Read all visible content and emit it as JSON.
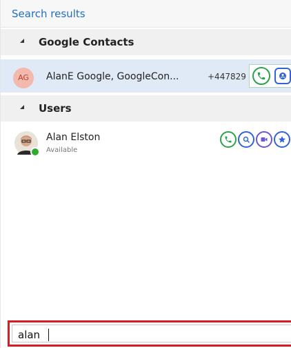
{
  "header": {
    "title": "Search results"
  },
  "groups": [
    {
      "label": "Google Contacts"
    },
    {
      "label": "Users"
    }
  ],
  "google_contact": {
    "initials": "AG",
    "name": "AlanE Google, GoogleCon...",
    "phone": "+447829",
    "actions": [
      "phone-icon",
      "contact-card-icon"
    ]
  },
  "user": {
    "name": "Alan Elston",
    "status": "Available",
    "presence_color": "#2eaa2e",
    "actions": [
      "phone-icon",
      "search-contact-icon",
      "video-icon",
      "star-icon"
    ]
  },
  "search": {
    "value": "alan",
    "border_color": "#d91c24"
  },
  "colors": {
    "accent": "#1f6fc6",
    "call_green": "#2aa24a",
    "action_blue": "#2f63d8"
  }
}
